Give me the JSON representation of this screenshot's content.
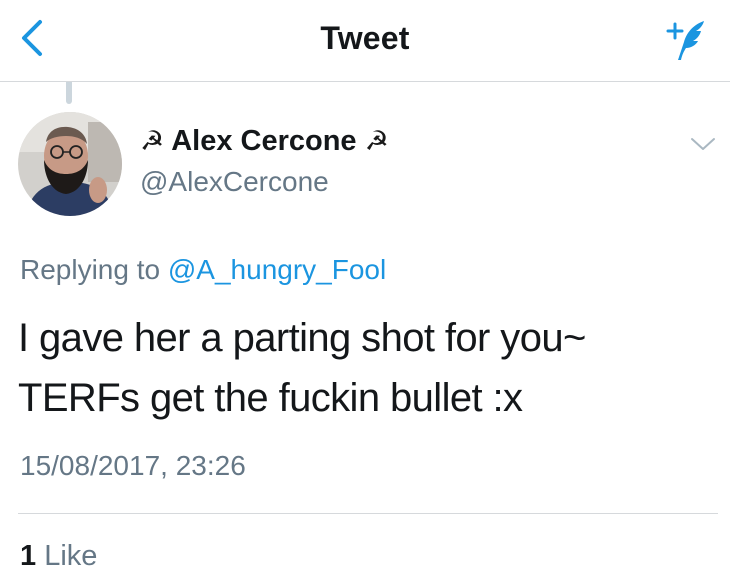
{
  "nav": {
    "title": "Tweet",
    "back_icon": "chevron-left-icon",
    "compose_icon": "compose-tweet-icon"
  },
  "author": {
    "name": "Alex Cercone",
    "name_prefix_emoji": "☭",
    "name_suffix_emoji": "☭",
    "handle": "@AlexCercone"
  },
  "tweet": {
    "replying_prefix": "Replying to",
    "replying_to": "@A_hungry_Fool",
    "text_line1": "I gave her a parting shot for you~",
    "text_line2": "TERFs get the fuckin bullet :x",
    "timestamp": "15/08/2017, 23:26"
  },
  "stats": {
    "likes_count": "1",
    "likes_label": "Like"
  },
  "colors": {
    "accent": "#1b95e0",
    "secondary_text": "#657786",
    "divider": "#d6d9dc"
  }
}
